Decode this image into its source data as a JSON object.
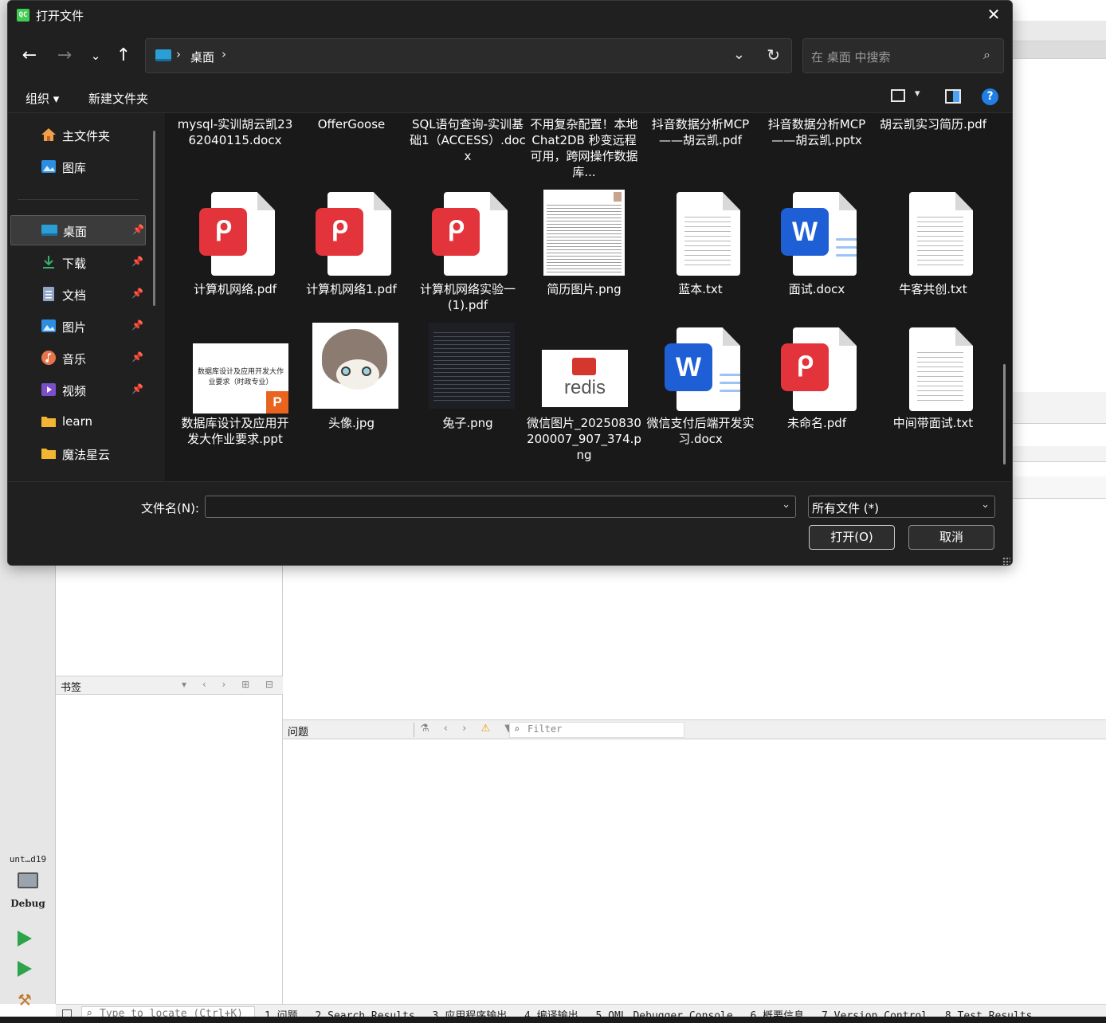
{
  "dialog": {
    "title": "打开文件",
    "app_badge": "QC",
    "close_glyph": "✕",
    "address": {
      "path_separator": "›",
      "location": "桌面",
      "search_placeholder": "在 桌面 中搜索"
    },
    "toolbar": {
      "organize": "组织 ▾",
      "new_folder": "新建文件夹",
      "help": "?"
    },
    "nav_items": [
      {
        "label": "主文件夹",
        "icon": "home-icon"
      },
      {
        "label": "图库",
        "icon": "gallery-icon"
      },
      {
        "label": "桌面",
        "icon": "desktop-icon",
        "selected": true,
        "pinned": true
      },
      {
        "label": "下载",
        "icon": "download-icon",
        "pinned": true
      },
      {
        "label": "文档",
        "icon": "documents-icon",
        "pinned": true
      },
      {
        "label": "图片",
        "icon": "pictures-icon",
        "pinned": true
      },
      {
        "label": "音乐",
        "icon": "music-icon",
        "pinned": true
      },
      {
        "label": "视频",
        "icon": "videos-icon",
        "pinned": true
      },
      {
        "label": "learn",
        "icon": "folder-icon"
      },
      {
        "label": "魔法星云",
        "icon": "folder-icon"
      }
    ],
    "files": [
      {
        "name": "mysql-实训胡云凯2362040115.docx",
        "kind": "partial"
      },
      {
        "name": "OfferGoose",
        "kind": "partial"
      },
      {
        "name": "SQL语句查询-实训基础1（ACCESS）.docx",
        "kind": "partial"
      },
      {
        "name": "不用复杂配置！本地 Chat2DB 秒变远程可用，跨网操作数据库...",
        "kind": "partial"
      },
      {
        "name": "抖音数据分析MCP——胡云凯.pdf",
        "kind": "partial"
      },
      {
        "name": "抖音数据分析MCP——胡云凯.pptx",
        "kind": "partial"
      },
      {
        "name": "胡云凯实习简历.pdf",
        "kind": "partial"
      },
      {
        "name": "计算机网络.pdf",
        "kind": "pdf"
      },
      {
        "name": "计算机网络1.pdf",
        "kind": "pdf"
      },
      {
        "name": "计算机网络实验一 (1).pdf",
        "kind": "pdf"
      },
      {
        "name": "简历图片.png",
        "kind": "resume"
      },
      {
        "name": "蓝本.txt",
        "kind": "txt"
      },
      {
        "name": "面试.docx",
        "kind": "word"
      },
      {
        "name": "牛客共创.txt",
        "kind": "txt"
      },
      {
        "name": "数据库设计及应用开发大作业要求.ppt",
        "kind": "ppt",
        "thumb_text": "数据库设计及应用开发大作业要求（时政专业）"
      },
      {
        "name": "头像.jpg",
        "kind": "avatar"
      },
      {
        "name": "兔子.png",
        "kind": "rabbit"
      },
      {
        "name": "微信图片_20250830200007_907_374.png",
        "kind": "redis",
        "thumb_text": "redis"
      },
      {
        "name": "微信支付后端开发实习.docx",
        "kind": "word"
      },
      {
        "name": "未命名.pdf",
        "kind": "pdf"
      },
      {
        "name": "中间带面试.txt",
        "kind": "txt"
      }
    ],
    "filename_label": "文件名(N):",
    "filename_value": "",
    "filetype": "所有文件 (*)",
    "open_button": "打开(O)",
    "cancel_button": "取消"
  },
  "ide": {
    "kit_name": "unt…d19",
    "kit_mode": "Debug",
    "bookmarks_title": "书签",
    "issues_title": "问题",
    "filter_placeholder": "Filter",
    "locator_placeholder": "Type to locate (Ctrl+K)",
    "output_tabs": [
      "1 问题",
      "2 Search Results",
      "3 应用程序输出",
      "4 编译输出",
      "5 QML Debugger Console",
      "6 概要信息",
      "7 Version Control",
      "8 Test Results"
    ]
  }
}
